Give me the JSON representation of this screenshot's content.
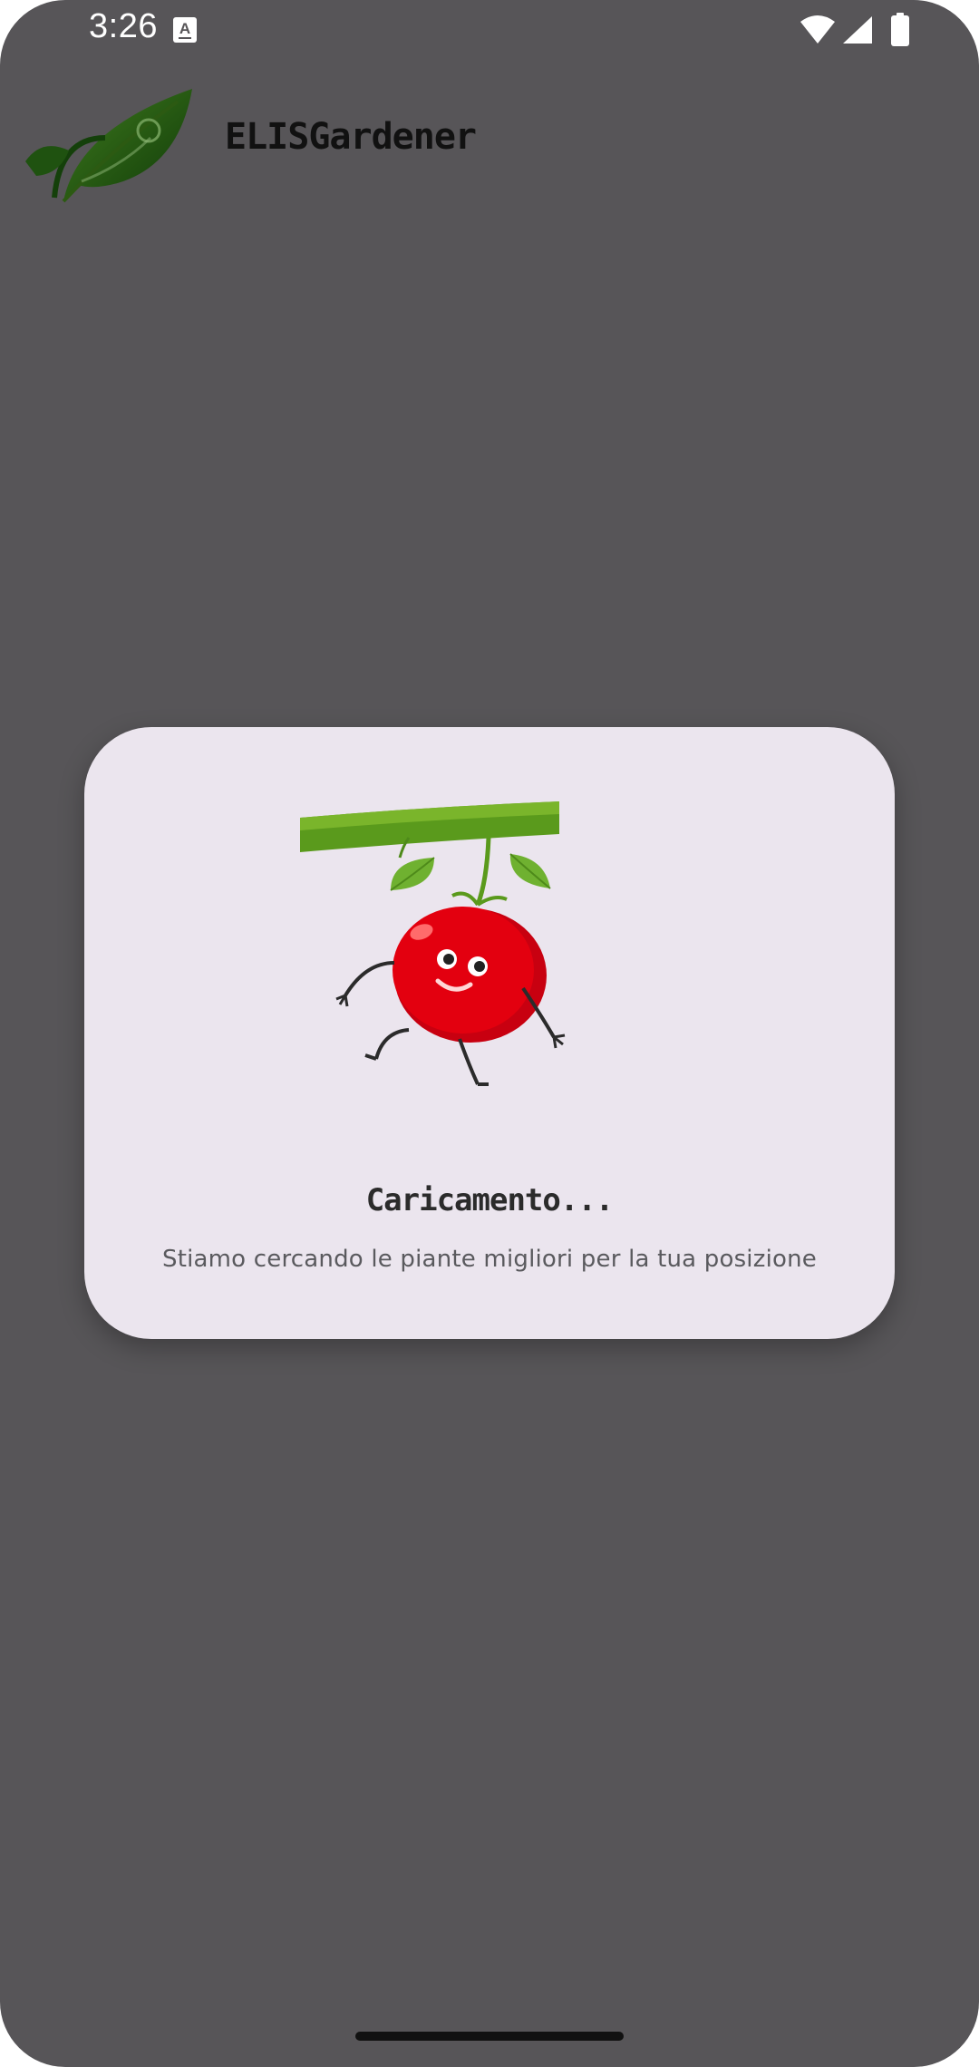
{
  "status_bar": {
    "time": "3:26",
    "notification_icon": "text-a-icon",
    "wifi_icon": "wifi-icon",
    "signal_icon": "cell-signal-icon",
    "battery_icon": "battery-icon"
  },
  "header": {
    "logo_icon": "leaf-logo-icon",
    "title": "ELISGardener"
  },
  "loading_dialog": {
    "illustration": "tomato-hanging-from-branch",
    "title": "Caricamento...",
    "subtitle": "Stiamo cercando le piante migliori per la tua posizione"
  },
  "colors": {
    "screen_background": "#575558",
    "dialog_background": "#ebe5ee",
    "title_text": "#111111",
    "tomato_red": "#e3000f",
    "branch_green": "#5a9a1c"
  }
}
